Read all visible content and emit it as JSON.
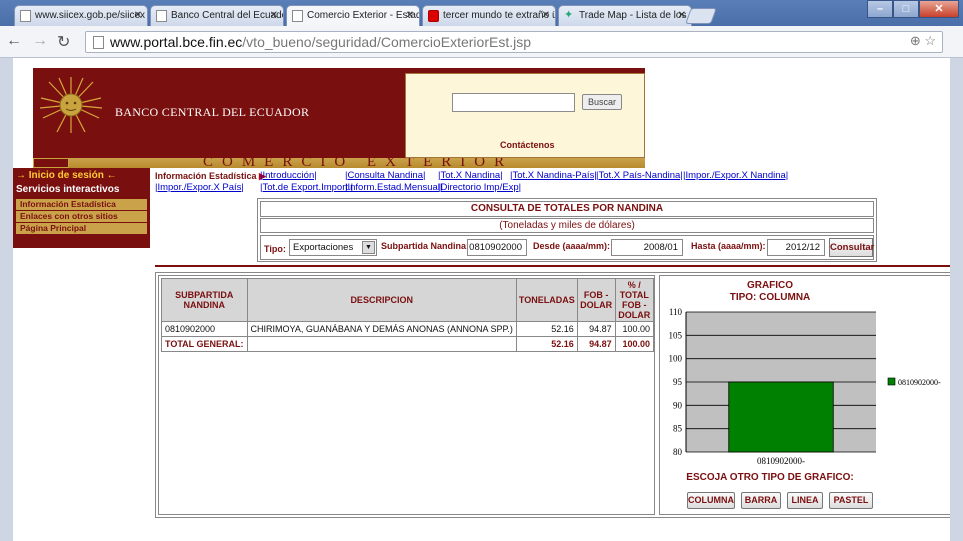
{
  "browser": {
    "tabs": [
      {
        "title": "www.siicex.gob.pe/siicex",
        "active": false
      },
      {
        "title": "Banco Central del Ecuador",
        "active": false
      },
      {
        "title": "Comercio Exterior - Estadí",
        "active": true
      },
      {
        "title": "tercer mundo te extraño ü",
        "active": false
      },
      {
        "title": "Trade Map - Lista de los m",
        "active": false
      }
    ],
    "address": {
      "host": "www.portal.bce.fin.ec",
      "path": "/vto_bueno/seguridad/ComercioExteriorEst.jsp"
    }
  },
  "header": {
    "bank_name": "BANCO CENTRAL DEL ECUADOR",
    "search_button": "Buscar",
    "search_value": "",
    "contact": "Contáctenos",
    "section_title": "COMERCIO EXTERIOR"
  },
  "leftnav": {
    "login": "→ Inicio de sesión ←",
    "services": "Servicios interactivos",
    "items": [
      "Información Estadística",
      "Enlaces con otros sitios",
      "Página Principal"
    ]
  },
  "submenu": {
    "current": "Información Estadística",
    "row1": [
      "|Introducción|",
      "|Consulta Nandina|",
      "|Tot.X Nandina|",
      "|Tot.X Nandina-País|",
      "|Tot.X País-Nandina|",
      "|Impor./Expor.X Nandina|"
    ],
    "row2": [
      "|Impor./Expor.X País|",
      "|Tot.de Export.Import.|",
      "|Inform.Estad.Mensual|",
      "|Directorio Imp/Exp|"
    ]
  },
  "query": {
    "title": "CONSULTA DE TOTALES POR NANDINA",
    "subtitle": "(Toneladas y miles de dólares)",
    "tipo_label": "Tipo:",
    "tipo_value": "Exportaciones",
    "subpartida_label": "Subpartida Nandina:",
    "subpartida_value": "0810902000",
    "desde_label": "Desde (aaaa/mm):",
    "desde_value": "2008/01",
    "hasta_label": "Hasta (aaaa/mm):",
    "hasta_value": "2012/12",
    "consultar": "Consultar"
  },
  "table": {
    "headers": [
      "SUBPARTIDA NANDINA",
      "DESCRIPCION",
      "TONELADAS",
      "FOB - DOLAR",
      "% / TOTAL FOB - DOLAR"
    ],
    "rows": [
      [
        "0810902000",
        "CHIRIMOYA, GUANÁBANA Y DEMÁS ANONAS (ANNONA SPP.)",
        "52.16",
        "94.87",
        "100.00"
      ]
    ],
    "total": [
      "TOTAL GENERAL:",
      "",
      "52.16",
      "94.87",
      "100.00"
    ]
  },
  "chart_panel": {
    "title_line1": "GRAFICO",
    "title_line2": "TIPO: COLUMNA",
    "choose_label": "ESCOJA OTRO TIPO DE GRAFICO:",
    "buttons": [
      "COLUMNA",
      "BARRA",
      "LINEA",
      "PASTEL"
    ],
    "plot_bg": "#c0c0c0",
    "bar_color": "#008000"
  },
  "chart_data": {
    "type": "bar",
    "categories": [
      "0810902000-"
    ],
    "series": [
      {
        "name": "0810902000-",
        "values": [
          95
        ]
      }
    ],
    "ylim": [
      80,
      110
    ],
    "yticks": [
      80,
      85,
      90,
      95,
      100,
      105,
      110
    ],
    "grid": true,
    "legend": "right"
  }
}
